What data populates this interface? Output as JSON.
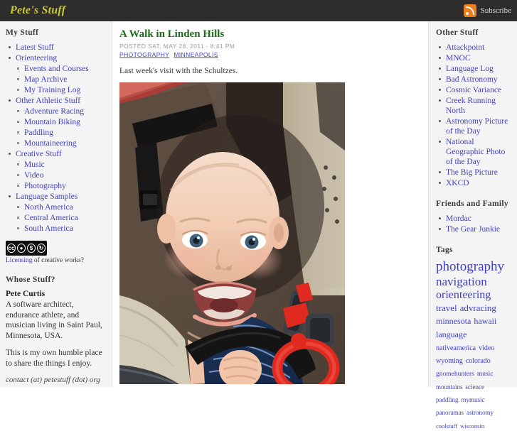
{
  "header": {
    "site_title": "Pete's Stuff",
    "subscribe_label": "Subscribe",
    "rss_icon": "rss-icon",
    "bg_color": "#2e2c2c",
    "title_color": "#c9c93a",
    "rss_color": "#ee7b1c"
  },
  "left_sidebar": {
    "heading": "My Stuff",
    "nav": [
      {
        "label": "Latest Stuff",
        "children": []
      },
      {
        "label": "Orienteering",
        "children": [
          "Events and Courses",
          "Map Archive",
          "My Training Log"
        ]
      },
      {
        "label": "Other Athletic Stuff",
        "children": [
          "Adventure Racing",
          "Mountain Biking",
          "Paddling",
          "Mountaineering"
        ]
      },
      {
        "label": "Creative Stuff",
        "children": [
          "Music",
          "Video",
          "Photography"
        ]
      },
      {
        "label": "Language Samples",
        "children": [
          "North America",
          "Central America",
          "South America"
        ]
      }
    ],
    "license": {
      "badge_icons": [
        "cc",
        "by",
        "nc",
        "sa"
      ],
      "link_text": "Licensing",
      "link_rest": " of creative works?"
    },
    "about": {
      "heading": "Whose Stuff?",
      "name": "Pete Curtis",
      "bio": "A software architect, endurance athlete, and musician living in Saint Paul, Minnesota, USA.",
      "note": "This is my own humble place to share the things I enjoy.",
      "contact": "contact (at) petestuff (dot) org"
    }
  },
  "article": {
    "title": "A Walk in Linden Hills",
    "meta": "POSTED SAT, MAY 28, 2011 - 8:41 PM",
    "tags": [
      "PHOTOGRAPHY",
      "MINNEAPOLIS"
    ],
    "body": "Last week's visit with the Schultzes.",
    "photo_alt": "Smiling baby in a backpack child carrier"
  },
  "right_sidebar": {
    "other_heading": "Other Stuff",
    "other_links": [
      "Attackpoint",
      "MNOC",
      "Language Log",
      "Bad Astronomy",
      "Cosmic Variance",
      "Creek Running North",
      "Astronomy Picture of the Day",
      "National Geographic Photo of the Day",
      "The Big Picture",
      "XKCD"
    ],
    "friends_heading": "Friends and Family",
    "friends_links": [
      "Mordac",
      "The Gear Junkie"
    ],
    "tags_heading": "Tags",
    "tag_cloud": [
      {
        "lines": [
          {
            "text": "photography",
            "size": "t1"
          }
        ]
      },
      {
        "lines": [
          {
            "text": "navigation",
            "size": "t2"
          }
        ]
      },
      {
        "lines": [
          {
            "text": "orienteering",
            "size": "t3"
          }
        ]
      },
      {
        "lines": [
          {
            "text": "travel",
            "size": "t4"
          },
          {
            "text": "advracing",
            "size": "t4"
          }
        ]
      },
      {
        "lines": [
          {
            "text": "minnesota",
            "size": "t5"
          },
          {
            "text": "hawaii",
            "size": "t5"
          }
        ]
      },
      {
        "lines": [
          {
            "text": "language",
            "size": "t5"
          }
        ]
      },
      {
        "lines": [
          {
            "text": "nativeamerica",
            "size": "t7"
          },
          {
            "text": "video",
            "size": "t7"
          }
        ]
      },
      {
        "lines": [
          {
            "text": "wyoming",
            "size": "t7"
          },
          {
            "text": "colorado",
            "size": "t7"
          }
        ]
      },
      {
        "lines": [
          {
            "text": "gnomehunters",
            "size": "t8"
          },
          {
            "text": "music",
            "size": "t8"
          }
        ]
      },
      {
        "lines": [
          {
            "text": "mountains",
            "size": "t9"
          },
          {
            "text": "science",
            "size": "t9"
          }
        ]
      },
      {
        "lines": [
          {
            "text": "paddling",
            "size": "t9"
          },
          {
            "text": "mymusic",
            "size": "t9"
          }
        ]
      },
      {
        "lines": [
          {
            "text": "panoramas",
            "size": "t9"
          },
          {
            "text": "astronomy",
            "size": "t9"
          }
        ]
      },
      {
        "lines": [
          {
            "text": "coolstuff",
            "size": "t10"
          },
          {
            "text": "wisconsin",
            "size": "t10"
          }
        ]
      }
    ]
  }
}
